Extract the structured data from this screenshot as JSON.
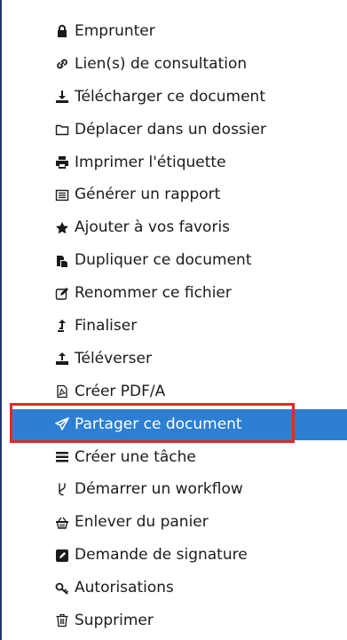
{
  "menu": {
    "items": [
      {
        "label": "Emprunter",
        "icon": "lock-icon"
      },
      {
        "label": "Lien(s) de consultation",
        "icon": "link-icon"
      },
      {
        "label": "Télécharger ce document",
        "icon": "download-icon"
      },
      {
        "label": "Déplacer dans un dossier",
        "icon": "folder-icon"
      },
      {
        "label": "Imprimer l'étiquette",
        "icon": "print-icon"
      },
      {
        "label": "Générer un rapport",
        "icon": "report-icon"
      },
      {
        "label": "Ajouter à vos favoris",
        "icon": "star-icon"
      },
      {
        "label": "Dupliquer ce document",
        "icon": "copy-icon"
      },
      {
        "label": "Renommer ce fichier",
        "icon": "edit-icon"
      },
      {
        "label": "Finaliser",
        "icon": "finalize-icon"
      },
      {
        "label": "Téléverser",
        "icon": "upload-icon"
      },
      {
        "label": "Créer PDF/A",
        "icon": "pdf-icon"
      },
      {
        "label": "Partager ce document",
        "icon": "share-icon"
      },
      {
        "label": "Créer une tâche",
        "icon": "task-icon"
      },
      {
        "label": "Démarrer un workflow",
        "icon": "workflow-icon"
      },
      {
        "label": "Enlever du panier",
        "icon": "basket-icon"
      },
      {
        "label": "Demande de signature",
        "icon": "signature-icon"
      },
      {
        "label": "Autorisations",
        "icon": "key-icon"
      },
      {
        "label": "Supprimer",
        "icon": "trash-icon"
      }
    ]
  },
  "colors": {
    "active_background": "#2c7fd3",
    "highlight_border": "#e62727",
    "text": "#1b1b1b",
    "left_border": "#1f3c66"
  }
}
